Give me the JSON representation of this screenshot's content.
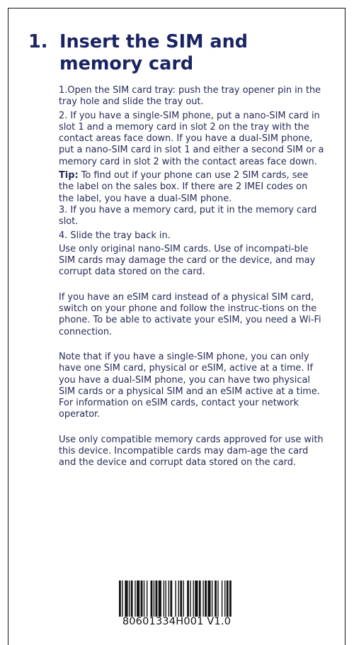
{
  "heading": {
    "number": "1.",
    "title": "Insert the SIM and memory card"
  },
  "steps": [
    "1.Open the SIM card tray: push the tray opener pin in the tray hole and slide the tray out.",
    "2. If you have a single-SIM phone, put a nano-SIM card in slot 1 and a memory card in slot 2 on the tray with the contact areas face down. If you have a dual-SIM phone, put a nano-SIM card in slot 1 and either a second SIM or a memory card in slot 2 with the contact areas face down."
  ],
  "tip": {
    "label": "Tip:",
    "text": " To find out if your phone can use 2 SIM cards, see the label on the sales box. If there are 2 IMEI codes on the label, you have a dual-SIM phone."
  },
  "steps_after": [
    "3. If you have a memory card, put it in the memory card slot.",
    "4. Slide the tray back in."
  ],
  "paragraphs": [
    "Use only original nano-SIM cards. Use of incompati-ble SIM cards may damage the card or the device, and may corrupt data stored on the card.",
    "If you have an eSIM card instead of a physical SIM card, switch on your phone and follow the instruc-tions on the phone. To be able to activate your eSIM, you need a Wi-Fi connection.",
    "Note that if you have a single-SIM phone, you can only have one SIM card, physical or eSIM, active at a time. If you have a dual-SIM phone, you can have two physical SIM cards or a physical SIM and an eSIM active at a time. For information on eSIM cards, contact your network operator.",
    "Use only compatible memory cards approved for use with this device. Incompatible cards may dam-age the card and the device and corrupt data stored on the card."
  ],
  "barcode": {
    "text": "80601334H001 V1.0"
  }
}
